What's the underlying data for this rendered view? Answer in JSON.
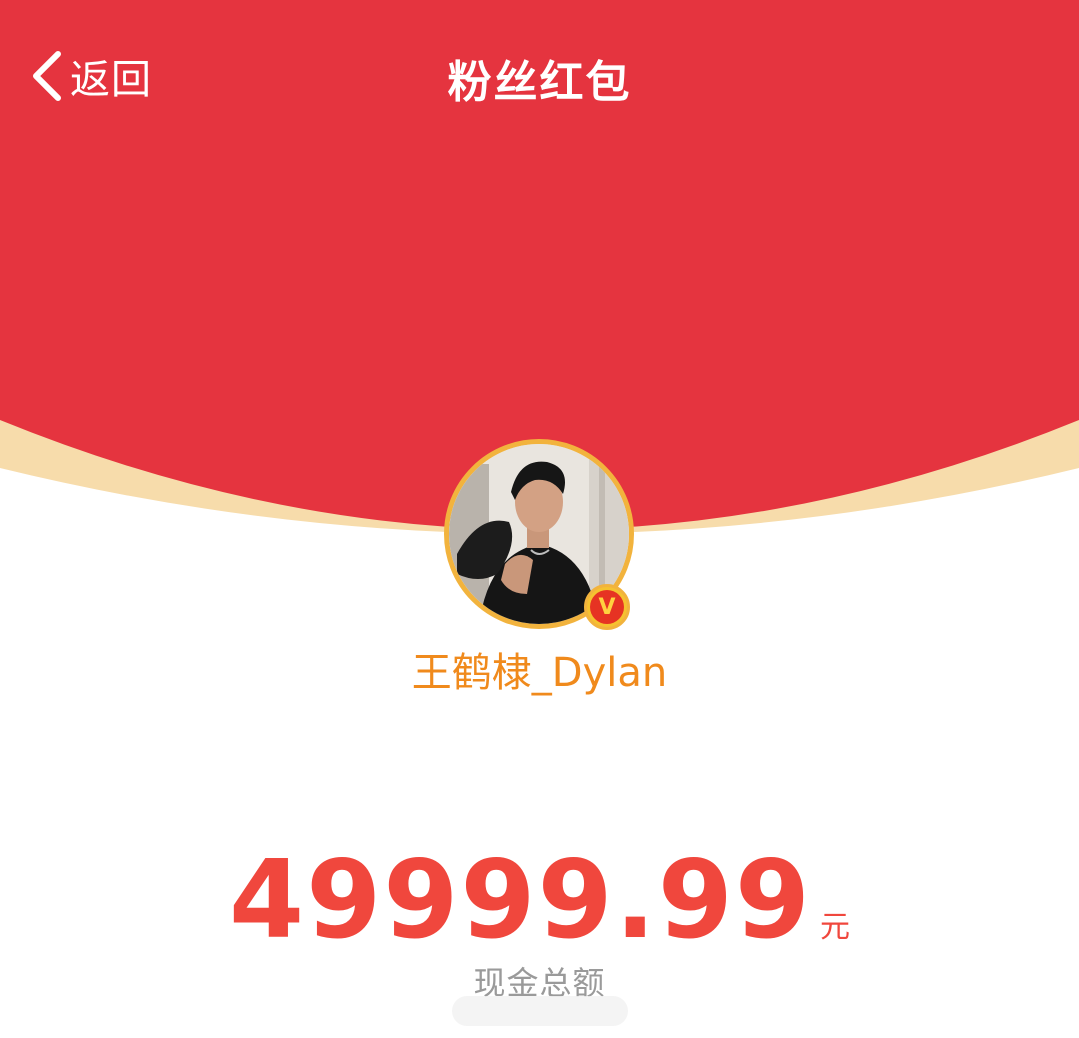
{
  "nav": {
    "back_label": "返回",
    "title": "粉丝红包"
  },
  "profile": {
    "username": "王鹤棣_Dylan",
    "verified_badge": "V"
  },
  "amount": {
    "value": "49999.99",
    "unit": "元",
    "caption": "现金总额"
  },
  "colors": {
    "header_red": "#e5343f",
    "cream_accent": "#f7dcab",
    "avatar_ring": "#f2b33d",
    "username_orange": "#f08a1c",
    "amount_red": "#f0473d",
    "caption_gray": "#9a9a9a"
  },
  "icons": {
    "back": "chevron-left-icon",
    "verified": "verified-v-icon"
  }
}
